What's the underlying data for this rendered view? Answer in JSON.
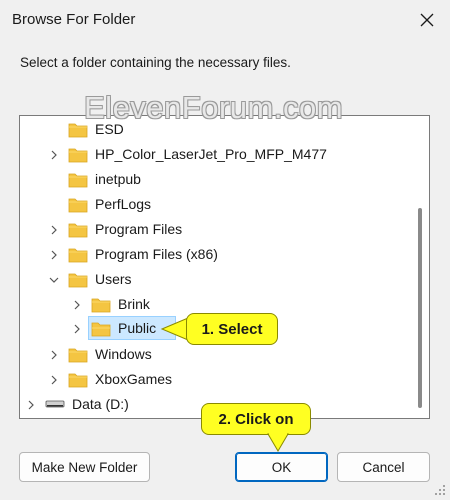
{
  "window": {
    "title": "Browse For Folder",
    "instruction": "Select a folder containing the necessary files.",
    "watermark": "ElevenForum.com"
  },
  "tree": {
    "items": [
      {
        "label": "ESD",
        "expandable": false
      },
      {
        "label": "HP_Color_LaserJet_Pro_MFP_M477",
        "expandable": true
      },
      {
        "label": "inetpub",
        "expandable": false
      },
      {
        "label": "PerfLogs",
        "expandable": false
      },
      {
        "label": "Program Files",
        "expandable": true
      },
      {
        "label": "Program Files (x86)",
        "expandable": true
      },
      {
        "label": "Users",
        "expandable": true,
        "expanded": true
      },
      {
        "label": "Brink",
        "expandable": true
      },
      {
        "label": "Public",
        "expandable": true,
        "selected": true
      },
      {
        "label": "Windows",
        "expandable": true
      },
      {
        "label": "XboxGames",
        "expandable": true
      },
      {
        "label": "Data (D:)",
        "expandable": true,
        "icon": "drive-icon"
      }
    ]
  },
  "callouts": {
    "select": "1. Select",
    "click": "2. Click on"
  },
  "buttons": {
    "make_new_folder": "Make New Folder",
    "ok": "OK",
    "cancel": "Cancel"
  },
  "colors": {
    "accent": "#0067c0",
    "selection": "#cce8ff",
    "callout": "#ffff22",
    "folder": "#f4c542"
  }
}
